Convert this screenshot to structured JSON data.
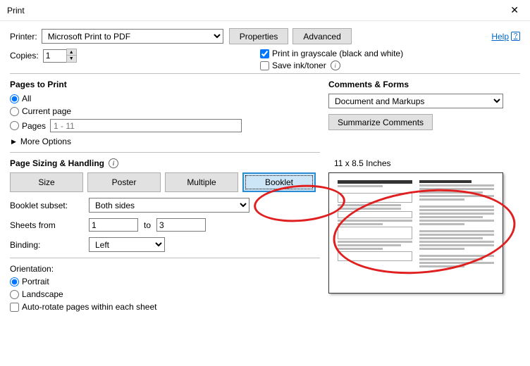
{
  "titlebar": {
    "title": "Print"
  },
  "toprow": {
    "printer_label": "Printer:",
    "printer_value": "Microsoft Print to PDF",
    "properties": "Properties",
    "advanced": "Advanced",
    "help": "Help"
  },
  "copies": {
    "label": "Copies:",
    "value": "1"
  },
  "options": {
    "grayscale": "Print in grayscale (black and white)",
    "saveink": "Save ink/toner"
  },
  "pages_to_print": {
    "heading": "Pages to Print",
    "all": "All",
    "current": "Current page",
    "pages": "Pages",
    "range_placeholder": "1 - 11",
    "more": "More Options"
  },
  "sizing": {
    "heading": "Page Sizing & Handling",
    "size": "Size",
    "poster": "Poster",
    "multiple": "Multiple",
    "booklet": "Booklet",
    "subset_label": "Booklet subset:",
    "subset_value": "Both sides",
    "sheets_from": "Sheets from",
    "sheets_from_val": "1",
    "to": "to",
    "sheets_to_val": "3",
    "binding_label": "Binding:",
    "binding_value": "Left"
  },
  "orientation": {
    "heading": "Orientation:",
    "portrait": "Portrait",
    "landscape": "Landscape",
    "auto": "Auto-rotate pages within each sheet"
  },
  "comments": {
    "heading": "Comments & Forms",
    "value": "Document and Markups",
    "summarize": "Summarize Comments"
  },
  "preview": {
    "dims": "11 x 8.5 Inches"
  }
}
